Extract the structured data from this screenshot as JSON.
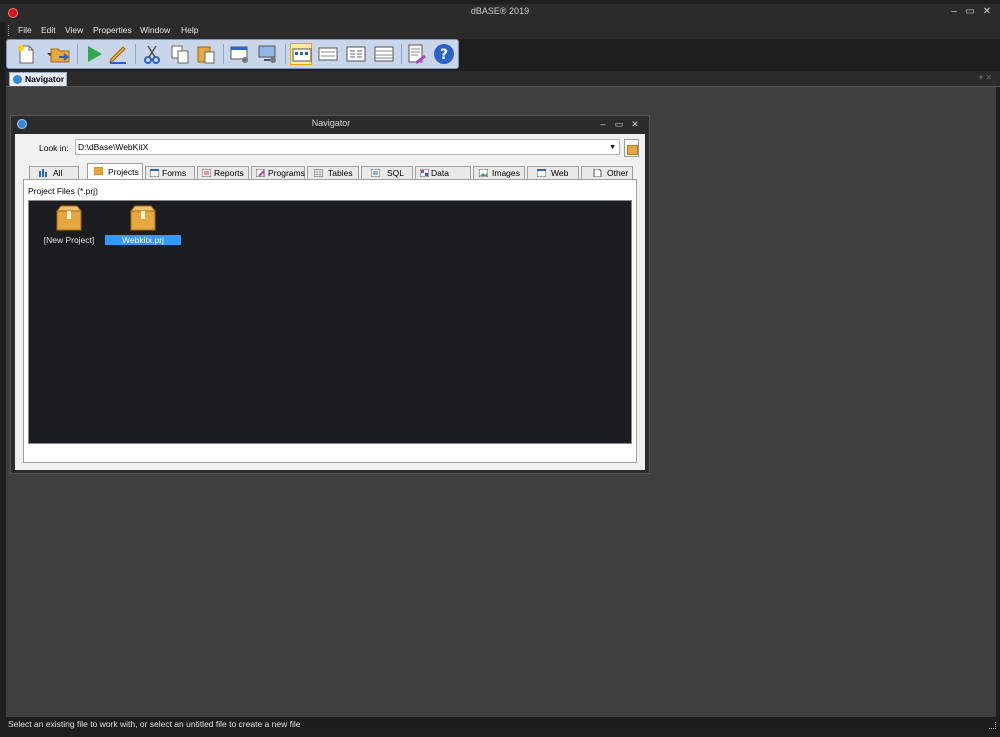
{
  "app": {
    "title": "dBASE® 2019"
  },
  "window_controls": {
    "minimize": "‒",
    "maximize": "▭",
    "close": "✕"
  },
  "menu": [
    "File",
    "Edit",
    "View",
    "Properties",
    "Window",
    "Help"
  ],
  "toolbar": {
    "buttons": [
      {
        "name": "new-file-icon"
      },
      {
        "name": "open-file-icon"
      },
      {
        "name": "run-icon"
      },
      {
        "name": "design-icon"
      },
      {
        "name": "cut-icon"
      },
      {
        "name": "copy-icon"
      },
      {
        "name": "paste-icon"
      },
      {
        "name": "form-properties-icon"
      },
      {
        "name": "desktop-properties-icon"
      },
      {
        "name": "view-large-icons-icon"
      },
      {
        "name": "view-small-icons-icon"
      },
      {
        "name": "view-list-icon"
      },
      {
        "name": "view-details-icon"
      },
      {
        "name": "command-window-icon"
      },
      {
        "name": "help-icon"
      }
    ]
  },
  "doc_tab": {
    "label": "Navigator"
  },
  "navigator": {
    "title": "Navigator",
    "look_in_label": "Look in:",
    "look_in_value": "D:\\dBase\\WebKitX",
    "tabs": [
      "All",
      "Projects",
      "Forms",
      "Reports",
      "Programs",
      "Tables",
      "SQL",
      "Data Modu",
      "Images",
      "Web",
      "Other"
    ],
    "active_tab": "Projects",
    "pane_label": "Project Files (*.prj)",
    "files": [
      {
        "name": "[New Project]",
        "selected": false
      },
      {
        "name": "Webkitx.prj",
        "selected": true
      }
    ]
  },
  "status": {
    "text": "Select an existing file to work with, or select an untitled file to create a new file"
  },
  "colors": {
    "accent": "#3399ff",
    "selection_highlight": "#fde9a4",
    "app_background": "#3f3f3f"
  }
}
